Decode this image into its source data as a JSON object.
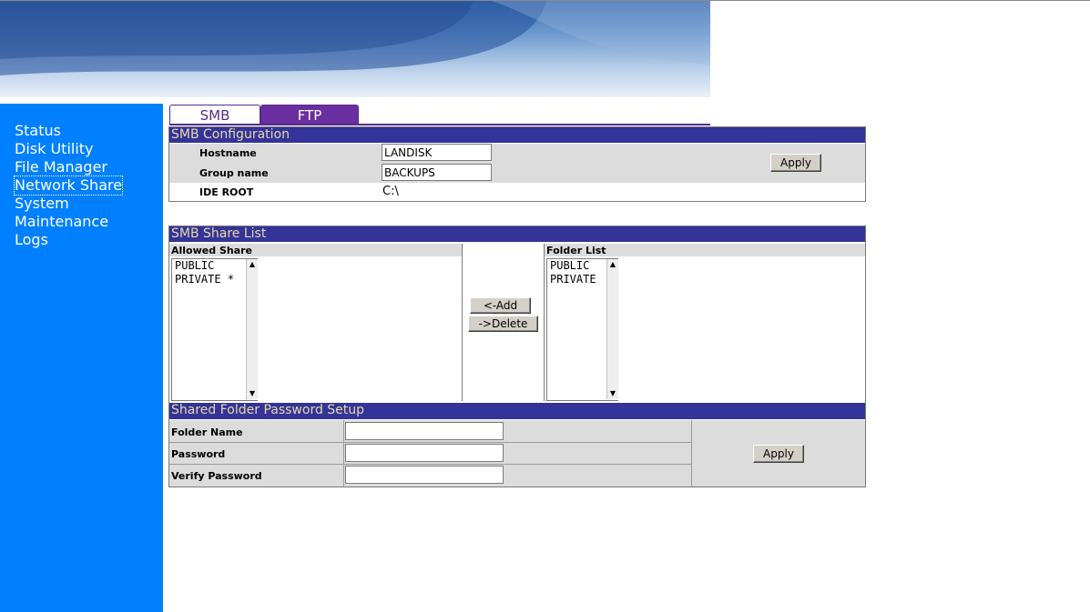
{
  "sidebar": {
    "items": [
      {
        "label": "Status"
      },
      {
        "label": "Disk Utility"
      },
      {
        "label": "File Manager"
      },
      {
        "label": "Network Share",
        "active": true
      },
      {
        "label": "System"
      },
      {
        "label": "Maintenance"
      },
      {
        "label": "Logs"
      }
    ]
  },
  "tabs": [
    {
      "label": "SMB",
      "selected": true
    },
    {
      "label": "FTP",
      "selected": false
    }
  ],
  "smb_config": {
    "title": "SMB Configuration",
    "hostname_label": "Hostname",
    "hostname_value": "LANDISK",
    "group_label": "Group name",
    "group_value": "BACKUPS",
    "ide_root_label": "IDE ROOT",
    "ide_root_value": "C:\\",
    "apply_label": "Apply"
  },
  "share_list": {
    "title": "SMB Share List",
    "allowed_header": "Allowed Share",
    "allowed_items": [
      "PUBLIC",
      "PRIVATE *"
    ],
    "folder_header": "Folder List",
    "folder_items": [
      "PUBLIC",
      "PRIVATE"
    ],
    "add_label": "<-Add",
    "delete_label": "->Delete"
  },
  "password_setup": {
    "title": "Shared Folder Password Setup",
    "folder_name_label": "Folder Name",
    "password_label": "Password",
    "verify_label": "Verify Password",
    "folder_name_value": "",
    "password_value": "",
    "verify_value": "",
    "apply_label": "Apply"
  },
  "colors": {
    "sidebar": "#0080ff",
    "section_header": "#333399",
    "section_header_text": "#e8d8a8",
    "tab_accent": "#6a2fa0"
  }
}
